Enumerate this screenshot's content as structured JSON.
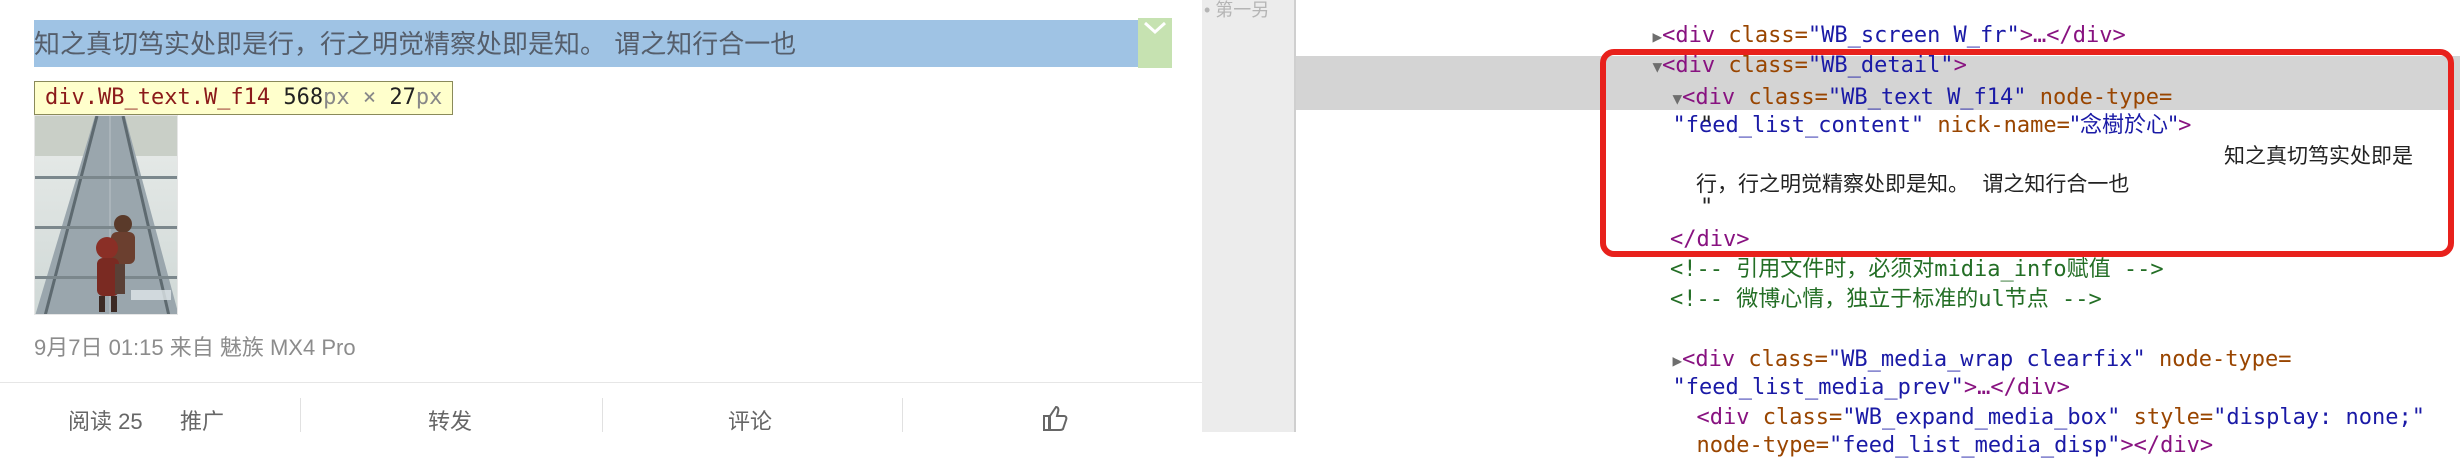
{
  "post": {
    "text": "知之真切笃实处即是行，行之明觉精察处即是知。 谓之知行合一也",
    "meta": "9月7日 01:15 来自 魅族 MX4 Pro"
  },
  "inspector_tooltip": {
    "selector": "div.WB_text.W_f14",
    "width": "568",
    "height": "27",
    "unit": "px",
    "times": "×"
  },
  "actions": {
    "read": "阅读 25",
    "promote": "推广",
    "forward": "转发",
    "comment": "评论"
  },
  "gutter": {
    "text": "• 第一另"
  },
  "devtools": {
    "lines": {
      "l1_tag_open": "<div ",
      "l1_attr": "class=",
      "l1_val": "\"WB_screen W_fr\"",
      "l1_rest": ">…</div>",
      "l2_tag_open": "<div ",
      "l2_attr": "class=",
      "l2_val": "\"WB_detail\"",
      "l2_rest": ">",
      "l3_tag_open": "<div ",
      "l3_attr1": "class=",
      "l3_val1": "\"WB_text W_f14\"",
      "l3_attr2": " node-type=",
      "l4_val2": "\"feed_list_content\"",
      "l4_attr3": " nick-name=",
      "l4_val3": "\"念樹於心\"",
      "l4_rest": ">",
      "l5_quote": "\"",
      "l6_text_right": "知之真切笃实处即是",
      "l7_text": "行，行之明觉精察处即是知。  谓之知行合一也",
      "l8_quote": "\"",
      "l9_close": "</div>",
      "c1": "<!-- 引用文件时，必须对midia_info赋值 -->",
      "c2": "<!-- 微博心情，独立于标准的ul节点 -->",
      "l12_tag_open": "<div ",
      "l12_attr1": "class=",
      "l12_val1": "\"WB_media_wrap clearfix\"",
      "l12_attr2": " node-type=",
      "l13_val2": "\"feed_list_media_prev\"",
      "l13_rest": ">…</div>",
      "l14_tag_open": "<div ",
      "l14_attr1": "class=",
      "l14_val1": "\"WB_expand_media_box\"",
      "l14_attr2": " style=",
      "l14_val2": "\"display: none;\"",
      "l15_attr": "node-type=",
      "l15_val": "\"feed_list_media_disp\"",
      "l15_rest": "></div>"
    }
  },
  "colors": {
    "highlight": "#9fc3e4",
    "red_box": "#e8211c",
    "tag": "#881280",
    "attr": "#994500",
    "value": "#1a1aa6",
    "comment": "#236e25"
  },
  "icons": [
    "chevron-down-icon",
    "like-thumb-icon",
    "expand-triangle-icon",
    "collapse-triangle-icon"
  ]
}
